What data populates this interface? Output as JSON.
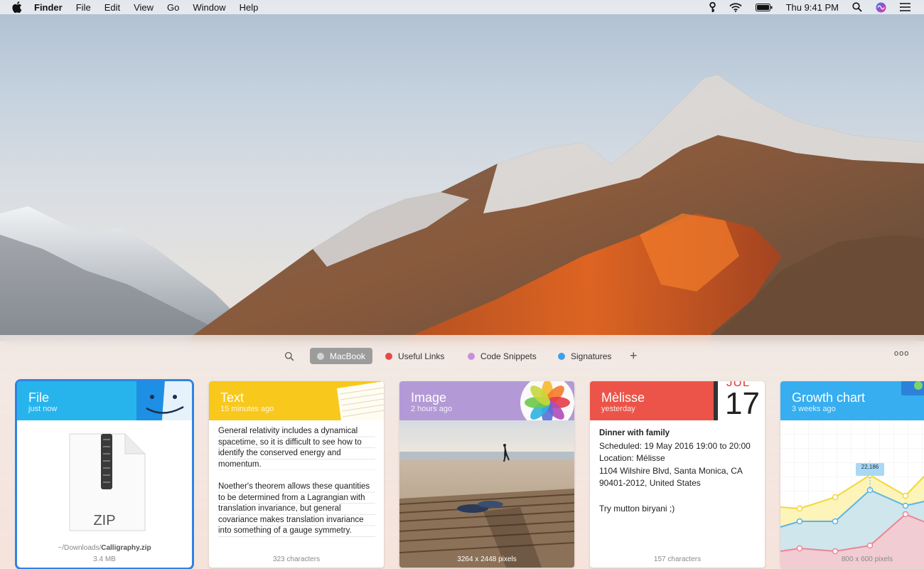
{
  "menubar": {
    "app_name": "Finder",
    "menus": [
      "File",
      "Edit",
      "View",
      "Go",
      "Window",
      "Help"
    ],
    "clock": "Thu 9:41 PM",
    "status_icons": [
      "key-icon",
      "wifi-icon",
      "battery-icon",
      "search-icon",
      "siri-icon",
      "control-center-icon"
    ]
  },
  "shelf": {
    "tabs": [
      {
        "label": "MacBook",
        "color": "#c8c8c8",
        "active": true
      },
      {
        "label": "Useful Links",
        "color": "#e84848",
        "active": false
      },
      {
        "label": "Code Snippets",
        "color": "#c98de0",
        "active": false
      },
      {
        "label": "Signatures",
        "color": "#3aa2ea",
        "active": false
      }
    ],
    "add_label": "+",
    "more_label": "ooo",
    "cards": {
      "file": {
        "title": "File",
        "time": "just now",
        "badge": "ZIP",
        "path_prefix": "~/Downloads/",
        "file_name": "Calligraphy.zip",
        "size": "3.4 MB",
        "color": "#27b4ec"
      },
      "text": {
        "title": "Text",
        "time": "15 minutes ago",
        "para1": "General relativity includes a dynamical spacetime, so it is difficult to see how to identify the conserved energy and momentum.",
        "para2": "Noether's theorem allows these quantities to be determined from a Lagrangian with translation invariance, but general covariance makes translation invariance into something of a gauge symmetry.",
        "footer": "323 characters",
        "color": "#f8c81c"
      },
      "image": {
        "title": "Image",
        "time": "2 hours ago",
        "footer": "3264 x 2448 pixels",
        "color": "#b39ad6"
      },
      "event": {
        "title": "Mèlisse",
        "time": "yesterday",
        "cal_month": "JUL",
        "cal_day": "17",
        "event_title": "Dinner with family",
        "scheduled": "Scheduled: 19 May 2016 19:00 to 20:00",
        "location": "Location: Mélisse",
        "address": "1104 Wilshire Blvd, Santa Monica, CA 90401-2012, United States",
        "note": "Try mutton biryani ;)",
        "footer": "157 characters",
        "color": "#ec5449"
      },
      "chart": {
        "title": "Growth chart",
        "time": "3 weeks ago",
        "callout": "22,186",
        "footer": "800 x 600 pixels",
        "color": "#36aef0"
      }
    }
  }
}
